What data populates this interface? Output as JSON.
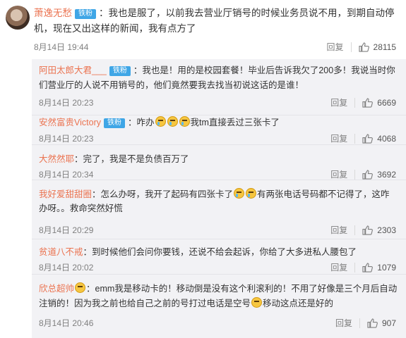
{
  "main": {
    "username": "萧逸无愁",
    "badge": "铁粉",
    "text": "：我也是服了，以前我去营业厅销号的时候业务员说不用，到期自动停机，现在又出这样的新闻，我有点方了",
    "time": "8月14日 19:44",
    "reply_label": "回复",
    "likes": "28115"
  },
  "replies": [
    {
      "username": "阿田太郎大君___",
      "badge": "铁粉",
      "text_a": "：我也是！用的是校园套餐！毕业后告诉我欠了200多！我说当时你们营业厅的人说不用销号的，他们竟然要我去找当初说这话的是谁！",
      "text_b": "",
      "time": "8月14日 20:23",
      "reply_label": "回复",
      "likes": "6669",
      "emoji_count": 0
    },
    {
      "username": "安然富贵Victory",
      "badge": "铁粉",
      "text_a": "：咋办",
      "text_b": "我tm直接丢过三张卡了",
      "time": "8月14日 20:23",
      "reply_label": "回复",
      "likes": "4068",
      "emoji_count": 3
    },
    {
      "username": "大然然耶",
      "badge": "",
      "text_a": "：完了，我是不是负债百万了",
      "text_b": "",
      "time": "8月14日 20:34",
      "reply_label": "回复",
      "likes": "3692",
      "emoji_count": 0
    },
    {
      "username": "我好爱甜甜圈",
      "badge": "",
      "text_a": "：怎么办呀，我开了起码有四张卡了",
      "text_b": "有两张电话号码都不记得了，这咋办呀。。救命突然好慌",
      "time": "8月14日 20:29",
      "reply_label": "回复",
      "likes": "2303",
      "emoji_count": 2
    },
    {
      "username": "贫道八不戒",
      "badge": "",
      "text_a": "：到时候他们会问你要钱，还说不给会起诉，你给了大多进私人腰包了",
      "text_b": "",
      "time": "8月14日 20:02",
      "reply_label": "回复",
      "likes": "1079",
      "emoji_count": 0
    },
    {
      "username": "欣总超帅",
      "badge": "",
      "text_a": "：emm我是移动卡的！移动倒是没有这个利滚利的！不用了好像是三个月后自动注销的！因为我之前也给自己之前的号打过电话是空号",
      "text_b": "移动这点还是好的",
      "time": "8月14日 20:46",
      "reply_label": "回复",
      "likes": "907",
      "emoji_count": 1
    }
  ]
}
